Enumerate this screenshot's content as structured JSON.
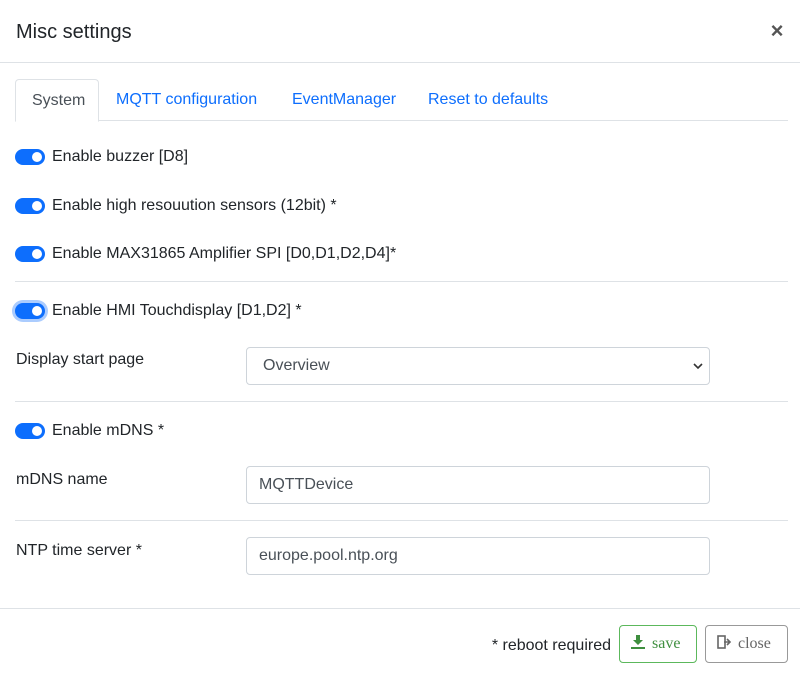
{
  "modal": {
    "title": "Misc settings",
    "close_glyph": "×"
  },
  "tabs": [
    {
      "label": "System",
      "active": true
    },
    {
      "label": "MQTT configuration",
      "active": false
    },
    {
      "label": "EventManager",
      "active": false
    },
    {
      "label": "Reset to defaults",
      "active": false
    }
  ],
  "toggles": {
    "buzzer": {
      "label": "Enable buzzer [D8]",
      "checked": true
    },
    "highres": {
      "label": "Enable high resouution sensors (12bit) *",
      "checked": true
    },
    "max31865": {
      "label": "Enable MAX31865 Amplifier SPI [D0,D1,D2,D4]*",
      "checked": true
    },
    "hmi": {
      "label": "Enable HMI Touchdisplay [D1,D2] *",
      "checked": true
    },
    "mdns": {
      "label": "Enable mDNS *",
      "checked": true
    }
  },
  "fields": {
    "display_start_page": {
      "label": "Display start page",
      "value": "Overview"
    },
    "mdns_name": {
      "label": "mDNS name",
      "value": "MQTTDevice"
    },
    "ntp_server": {
      "label": "NTP time server *",
      "value": "europe.pool.ntp.org"
    }
  },
  "footer": {
    "note": "* reboot required",
    "save_label": "save",
    "close_label": "close"
  },
  "colors": {
    "accent": "#0d6efd",
    "save": "#5cb85c",
    "close": "#999999"
  },
  "icons": {
    "close": "close-icon",
    "select": "chevron-down-icon",
    "save": "download-icon",
    "exit": "sign-out-icon"
  }
}
